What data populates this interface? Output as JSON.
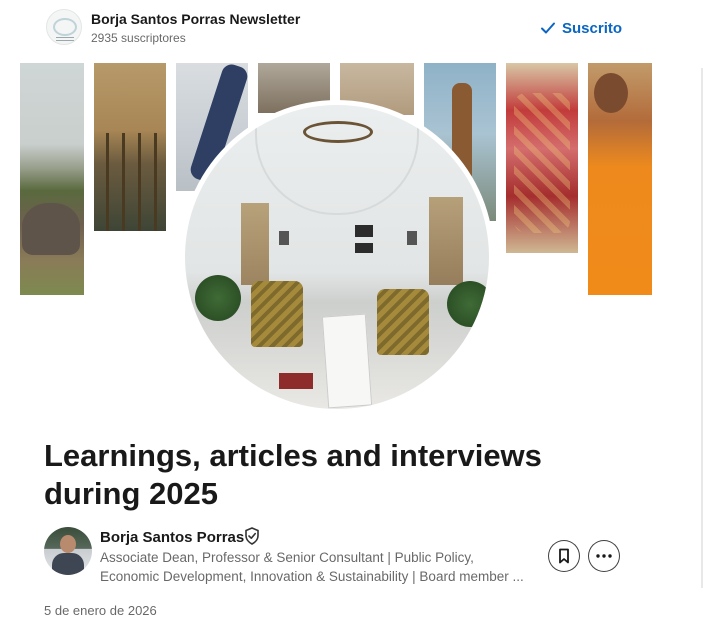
{
  "newsletter": {
    "title": "Borja Santos Porras Newsletter",
    "subscribers": "2935 suscriptores",
    "subscribe_state_label": "Suscrito",
    "check_icon": "checkmark-icon"
  },
  "article": {
    "title": "Learnings, articles and interviews during 2025",
    "date": "5 de enero de 2026"
  },
  "author": {
    "name": "Borja Santos Porras",
    "badge_icon": "verified-shield-icon",
    "bio_line1": "Associate Dean, Professor & Senior Consultant | Public Policy,",
    "bio_line2": "Economic Development, Innovation & Sustainability | Board member ..."
  },
  "actions": {
    "save_icon": "bookmark-icon",
    "more_icon": "more-horizontal-icon"
  },
  "colors": {
    "accent": "#0a66c2",
    "text_primary": "#191919",
    "text_secondary": "#666666"
  }
}
